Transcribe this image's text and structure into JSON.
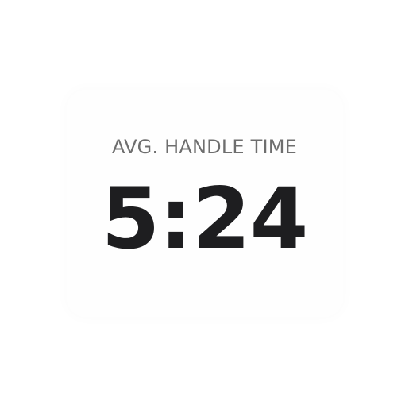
{
  "metric": {
    "label": "AVG. HANDLE TIME",
    "value": "5:24"
  },
  "colors": {
    "background": "#ffffff",
    "card": "#fefefe",
    "label_text": "#6e6e6e",
    "value_text": "#1e1e20"
  }
}
